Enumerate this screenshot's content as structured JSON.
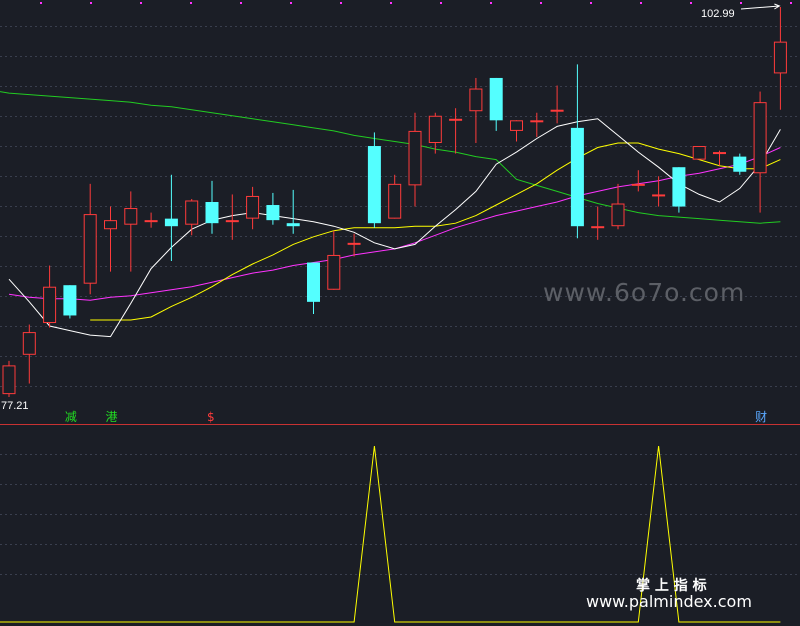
{
  "chart_data": {
    "type": "candlestick",
    "price_scale": {
      "min": 77.21,
      "max": 102.99
    },
    "labels": {
      "high": "102.99",
      "low": "77.21"
    },
    "colors": {
      "up": "#ff3b3b",
      "down": "#54ffff",
      "ma5": "#ffffff",
      "ma10": "#ffff00",
      "ma20": "#ff33ff",
      "ma60": "#22cc22",
      "signal": "#ffff00",
      "grid": "#3a3f4e",
      "separator": "#c83232",
      "bg": "#1b1e26"
    },
    "candles": [
      {
        "o": 77.4,
        "h": 79.6,
        "l": 77.21,
        "c": 79.3
      },
      {
        "o": 80.0,
        "h": 82.0,
        "l": 78.1,
        "c": 81.5
      },
      {
        "o": 82.1,
        "h": 85.9,
        "l": 81.8,
        "c": 84.5
      },
      {
        "o": 84.6,
        "h": 84.6,
        "l": 82.4,
        "c": 82.6
      },
      {
        "o": 84.7,
        "h": 91.3,
        "l": 84.0,
        "c": 89.3
      },
      {
        "o": 88.3,
        "h": 89.8,
        "l": 85.5,
        "c": 88.9
      },
      {
        "o": 88.6,
        "h": 90.8,
        "l": 85.5,
        "c": 89.7
      },
      {
        "o": 88.9,
        "h": 89.4,
        "l": 88.4,
        "c": 88.9
      },
      {
        "o": 89.0,
        "h": 91.9,
        "l": 86.2,
        "c": 88.5
      },
      {
        "o": 88.6,
        "h": 90.3,
        "l": 87.9,
        "c": 90.2
      },
      {
        "o": 90.1,
        "h": 91.5,
        "l": 88.0,
        "c": 88.7
      },
      {
        "o": 88.8,
        "h": 90.6,
        "l": 87.6,
        "c": 88.9
      },
      {
        "o": 89.0,
        "h": 91.1,
        "l": 88.3,
        "c": 90.5
      },
      {
        "o": 89.9,
        "h": 90.7,
        "l": 88.6,
        "c": 88.9
      },
      {
        "o": 88.7,
        "h": 90.9,
        "l": 88.0,
        "c": 88.5
      },
      {
        "o": 86.1,
        "h": 86.1,
        "l": 82.7,
        "c": 83.5
      },
      {
        "o": 84.3,
        "h": 88.2,
        "l": 84.3,
        "c": 86.6
      },
      {
        "o": 87.4,
        "h": 88.0,
        "l": 86.5,
        "c": 87.4
      },
      {
        "o": 93.8,
        "h": 94.7,
        "l": 88.4,
        "c": 88.7
      },
      {
        "o": 89.0,
        "h": 91.9,
        "l": 89.0,
        "c": 91.3
      },
      {
        "o": 91.2,
        "h": 96.0,
        "l": 89.8,
        "c": 94.8
      },
      {
        "o": 94.0,
        "h": 96.0,
        "l": 93.3,
        "c": 95.8
      },
      {
        "o": 95.5,
        "h": 96.3,
        "l": 93.3,
        "c": 95.6
      },
      {
        "o": 96.1,
        "h": 98.3,
        "l": 94.0,
        "c": 97.6
      },
      {
        "o": 98.3,
        "h": 98.3,
        "l": 94.8,
        "c": 95.5
      },
      {
        "o": 94.8,
        "h": 95.5,
        "l": 94.1,
        "c": 95.5
      },
      {
        "o": 95.5,
        "h": 96.0,
        "l": 94.4,
        "c": 95.5
      },
      {
        "o": 96.2,
        "h": 97.8,
        "l": 95.3,
        "c": 96.2
      },
      {
        "o": 95.0,
        "h": 99.2,
        "l": 87.7,
        "c": 88.5
      },
      {
        "o": 88.5,
        "h": 89.8,
        "l": 87.6,
        "c": 88.5
      },
      {
        "o": 88.5,
        "h": 91.3,
        "l": 88.3,
        "c": 90.0
      },
      {
        "o": 91.3,
        "h": 92.2,
        "l": 90.8,
        "c": 91.3
      },
      {
        "o": 90.6,
        "h": 91.8,
        "l": 89.8,
        "c": 90.6
      },
      {
        "o": 92.4,
        "h": 92.4,
        "l": 89.4,
        "c": 89.8
      },
      {
        "o": 92.9,
        "h": 93.8,
        "l": 92.9,
        "c": 93.8
      },
      {
        "o": 93.4,
        "h": 93.5,
        "l": 92.5,
        "c": 93.4
      },
      {
        "o": 93.1,
        "h": 93.3,
        "l": 91.9,
        "c": 92.1
      },
      {
        "o": 92.0,
        "h": 97.4,
        "l": 89.4,
        "c": 96.7
      },
      {
        "o": 98.6,
        "h": 102.99,
        "l": 96.2,
        "c": 100.7
      }
    ],
    "ma": {
      "ma5": [
        85.0,
        83.5,
        81.9,
        81.6,
        81.3,
        81.2,
        83.4,
        85.7,
        87.1,
        88.3,
        88.9,
        89.2,
        89.4,
        89.2,
        89.0,
        88.8,
        88.5,
        88.1,
        87.4,
        87.0,
        87.3,
        88.5,
        89.6,
        90.8,
        92.6,
        93.4,
        94.3,
        95.1,
        95.4,
        95.6,
        94.5,
        93.4,
        92.4,
        91.3,
        90.6,
        90.1,
        91.0,
        92.6,
        94.9
      ],
      "ma10": [
        null,
        null,
        null,
        null,
        82.3,
        82.3,
        82.3,
        82.5,
        83.2,
        83.8,
        84.5,
        85.3,
        86.0,
        86.6,
        87.3,
        87.8,
        88.2,
        88.4,
        88.4,
        88.4,
        88.5,
        88.5,
        88.7,
        89.2,
        89.9,
        90.6,
        91.3,
        92.2,
        93.0,
        93.7,
        94.0,
        94.0,
        93.6,
        93.3,
        92.9,
        92.5,
        92.3,
        92.3,
        92.9
      ],
      "ma20": [
        84.0,
        83.8,
        83.7,
        83.7,
        83.6,
        83.8,
        83.9,
        84.1,
        84.3,
        84.5,
        84.8,
        85.1,
        85.4,
        85.6,
        85.9,
        86.1,
        86.3,
        86.6,
        86.8,
        87.0,
        87.4,
        87.9,
        88.4,
        88.8,
        89.2,
        89.5,
        89.8,
        90.1,
        90.5,
        90.8,
        91.1,
        91.3,
        91.5,
        91.8,
        92.0,
        92.3,
        92.6,
        93.1,
        93.7
      ],
      "ma60": [
        97.3,
        97.2,
        97.1,
        97.0,
        96.9,
        96.8,
        96.7,
        96.5,
        96.4,
        96.2,
        96.0,
        95.8,
        95.6,
        95.4,
        95.2,
        95.0,
        94.8,
        94.5,
        94.3,
        94.1,
        93.9,
        93.6,
        93.4,
        93.1,
        92.9,
        91.6,
        91.2,
        90.8,
        90.4,
        90.0,
        89.7,
        89.4,
        89.2,
        89.1,
        89.0,
        88.9,
        88.8,
        88.7,
        88.8
      ]
    },
    "signal": {
      "peaks": [
        18,
        32
      ],
      "peak_level": 1,
      "base_level": 0
    },
    "markers": [
      {
        "index": 3,
        "text": "减",
        "color": "#22dd22"
      },
      {
        "index": 5,
        "text": "港",
        "color": "#22dd22"
      },
      {
        "index": 10,
        "text": "$",
        "color": "#ff3b3b"
      },
      {
        "index": 37,
        "text": "财",
        "color": "#5aa8ff"
      }
    ]
  },
  "watermarks": {
    "site1": "www.6o7o.com",
    "brand": "掌 上 指 标",
    "site2": "www.palmindex.com"
  }
}
